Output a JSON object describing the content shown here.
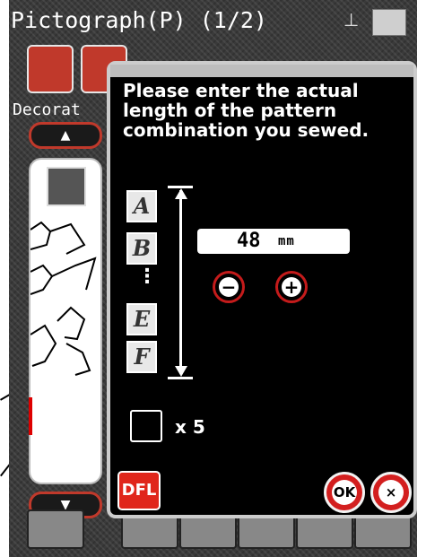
{
  "header": {
    "title": "Pictograph(P) (1/2)",
    "category_label": "Decorat"
  },
  "dialog": {
    "prompt_lines": [
      "Please enter the actual",
      "length of the pattern",
      "combination you sewed."
    ],
    "patterns": [
      "A",
      "B",
      "E",
      "F"
    ],
    "ellipsis": "⋮",
    "length_value": "48",
    "length_unit": "mm",
    "minus_label": "−",
    "plus_label": "+",
    "checkbox_checked": false,
    "repeat_label": "x 5",
    "dfl_label": "DFL",
    "ok_label": "OK",
    "cancel_label": "×"
  },
  "icons": {
    "scroll_up": "▲",
    "scroll_down": "▼"
  },
  "colors": {
    "accent_red": "#d31f1f",
    "dialog_bg": "#000000",
    "text": "#ffffff"
  }
}
